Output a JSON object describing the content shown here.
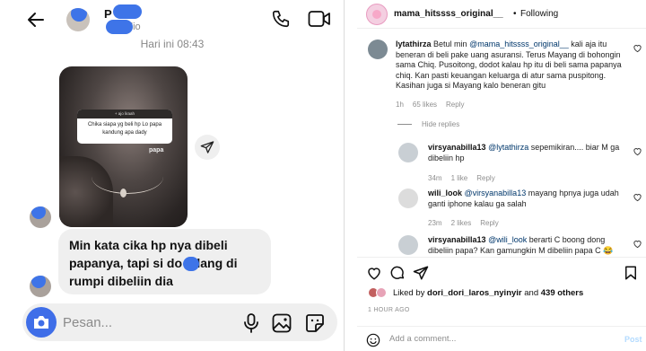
{
  "chat": {
    "contact_name": "P o",
    "contact_sub": "dio",
    "timestamp": "Hari ini 08:43",
    "media": {
      "question_header": "+ ajo liraah",
      "question_text": "Chika siapa yg beli hp Lo papa kandung apa dady",
      "caption": "papa"
    },
    "message": "Min kata cika hp nya dibeli papanya, tapi si do  bilang di rumpi dibeliin dia",
    "composer_placeholder": "Pesan..."
  },
  "post": {
    "username": "mama_hitssss_original__",
    "separator": "•",
    "follow_status": "Following",
    "comments": [
      {
        "user": "lytathirza",
        "text_before": "Betul min ",
        "mention": "@mama_hitssss_original__",
        "text_after": " kali aja itu beneran di beli pake uang asuransi. Terus Mayang di bohongin sama Chiq. Pusoitong, dodot kalau hp itu di beli sama papanya chiq. Kan pasti keuangan keluarga di atur sama puspitong. Kasihan juga si Mayang kalo beneran gitu",
        "time": "1h",
        "likes": "65 likes",
        "reply": "Reply"
      }
    ],
    "hide_replies": "Hide replies",
    "replies": [
      {
        "user": "virsyanabilla13",
        "mention": "@lytathirza",
        "text": " sepemikiran.... biar M ga dibeliin hp",
        "time": "34m",
        "likes": "1 like",
        "reply": "Reply"
      },
      {
        "user": "wili_look",
        "mention": "@virsyanabilla13",
        "text": " mayang hpnya juga udah ganti iphone kalau ga salah",
        "time": "23m",
        "likes": "2 likes",
        "reply": "Reply"
      },
      {
        "user": "virsyanabilla13",
        "mention": "@wili_look",
        "text": " berarti C boong dong dibeliin papa? Kan gamungkin M dibeliin papa C 😂",
        "time": "",
        "likes": "",
        "reply": ""
      }
    ],
    "liked_by_prefix": "Liked by ",
    "liked_by_user": "dori_dori_laros_nyinyir",
    "liked_by_mid": " and ",
    "liked_by_others": "439 others",
    "time_ago": "1 HOUR AGO",
    "add_comment_placeholder": "Add a comment...",
    "post_label": "Post"
  },
  "colors": {
    "messenger_blue": "#3f6ee8",
    "mention_blue": "#00376b",
    "post_disabled": "#b3dbff"
  },
  "icons": [
    "back-arrow-icon",
    "phone-icon",
    "video-icon",
    "share-icon",
    "camera-icon",
    "mic-icon",
    "gallery-icon",
    "sticker-icon",
    "heart-icon",
    "comment-icon",
    "send-icon",
    "bookmark-icon",
    "emoji-icon"
  ]
}
